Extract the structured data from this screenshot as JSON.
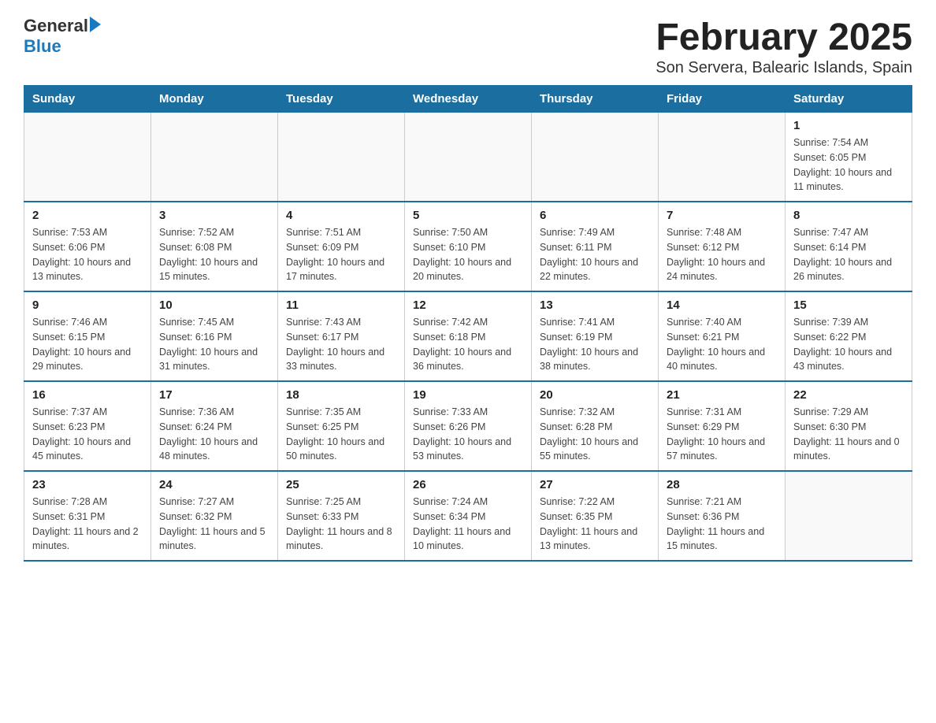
{
  "header": {
    "logo_text_general": "General",
    "logo_text_blue": "Blue",
    "title": "February 2025",
    "subtitle": "Son Servera, Balearic Islands, Spain"
  },
  "days_of_week": [
    "Sunday",
    "Monday",
    "Tuesday",
    "Wednesday",
    "Thursday",
    "Friday",
    "Saturday"
  ],
  "weeks": [
    [
      {
        "day": "",
        "info": ""
      },
      {
        "day": "",
        "info": ""
      },
      {
        "day": "",
        "info": ""
      },
      {
        "day": "",
        "info": ""
      },
      {
        "day": "",
        "info": ""
      },
      {
        "day": "",
        "info": ""
      },
      {
        "day": "1",
        "info": "Sunrise: 7:54 AM\nSunset: 6:05 PM\nDaylight: 10 hours and 11 minutes."
      }
    ],
    [
      {
        "day": "2",
        "info": "Sunrise: 7:53 AM\nSunset: 6:06 PM\nDaylight: 10 hours and 13 minutes."
      },
      {
        "day": "3",
        "info": "Sunrise: 7:52 AM\nSunset: 6:08 PM\nDaylight: 10 hours and 15 minutes."
      },
      {
        "day": "4",
        "info": "Sunrise: 7:51 AM\nSunset: 6:09 PM\nDaylight: 10 hours and 17 minutes."
      },
      {
        "day": "5",
        "info": "Sunrise: 7:50 AM\nSunset: 6:10 PM\nDaylight: 10 hours and 20 minutes."
      },
      {
        "day": "6",
        "info": "Sunrise: 7:49 AM\nSunset: 6:11 PM\nDaylight: 10 hours and 22 minutes."
      },
      {
        "day": "7",
        "info": "Sunrise: 7:48 AM\nSunset: 6:12 PM\nDaylight: 10 hours and 24 minutes."
      },
      {
        "day": "8",
        "info": "Sunrise: 7:47 AM\nSunset: 6:14 PM\nDaylight: 10 hours and 26 minutes."
      }
    ],
    [
      {
        "day": "9",
        "info": "Sunrise: 7:46 AM\nSunset: 6:15 PM\nDaylight: 10 hours and 29 minutes."
      },
      {
        "day": "10",
        "info": "Sunrise: 7:45 AM\nSunset: 6:16 PM\nDaylight: 10 hours and 31 minutes."
      },
      {
        "day": "11",
        "info": "Sunrise: 7:43 AM\nSunset: 6:17 PM\nDaylight: 10 hours and 33 minutes."
      },
      {
        "day": "12",
        "info": "Sunrise: 7:42 AM\nSunset: 6:18 PM\nDaylight: 10 hours and 36 minutes."
      },
      {
        "day": "13",
        "info": "Sunrise: 7:41 AM\nSunset: 6:19 PM\nDaylight: 10 hours and 38 minutes."
      },
      {
        "day": "14",
        "info": "Sunrise: 7:40 AM\nSunset: 6:21 PM\nDaylight: 10 hours and 40 minutes."
      },
      {
        "day": "15",
        "info": "Sunrise: 7:39 AM\nSunset: 6:22 PM\nDaylight: 10 hours and 43 minutes."
      }
    ],
    [
      {
        "day": "16",
        "info": "Sunrise: 7:37 AM\nSunset: 6:23 PM\nDaylight: 10 hours and 45 minutes."
      },
      {
        "day": "17",
        "info": "Sunrise: 7:36 AM\nSunset: 6:24 PM\nDaylight: 10 hours and 48 minutes."
      },
      {
        "day": "18",
        "info": "Sunrise: 7:35 AM\nSunset: 6:25 PM\nDaylight: 10 hours and 50 minutes."
      },
      {
        "day": "19",
        "info": "Sunrise: 7:33 AM\nSunset: 6:26 PM\nDaylight: 10 hours and 53 minutes."
      },
      {
        "day": "20",
        "info": "Sunrise: 7:32 AM\nSunset: 6:28 PM\nDaylight: 10 hours and 55 minutes."
      },
      {
        "day": "21",
        "info": "Sunrise: 7:31 AM\nSunset: 6:29 PM\nDaylight: 10 hours and 57 minutes."
      },
      {
        "day": "22",
        "info": "Sunrise: 7:29 AM\nSunset: 6:30 PM\nDaylight: 11 hours and 0 minutes."
      }
    ],
    [
      {
        "day": "23",
        "info": "Sunrise: 7:28 AM\nSunset: 6:31 PM\nDaylight: 11 hours and 2 minutes."
      },
      {
        "day": "24",
        "info": "Sunrise: 7:27 AM\nSunset: 6:32 PM\nDaylight: 11 hours and 5 minutes."
      },
      {
        "day": "25",
        "info": "Sunrise: 7:25 AM\nSunset: 6:33 PM\nDaylight: 11 hours and 8 minutes."
      },
      {
        "day": "26",
        "info": "Sunrise: 7:24 AM\nSunset: 6:34 PM\nDaylight: 11 hours and 10 minutes."
      },
      {
        "day": "27",
        "info": "Sunrise: 7:22 AM\nSunset: 6:35 PM\nDaylight: 11 hours and 13 minutes."
      },
      {
        "day": "28",
        "info": "Sunrise: 7:21 AM\nSunset: 6:36 PM\nDaylight: 11 hours and 15 minutes."
      },
      {
        "day": "",
        "info": ""
      }
    ]
  ]
}
